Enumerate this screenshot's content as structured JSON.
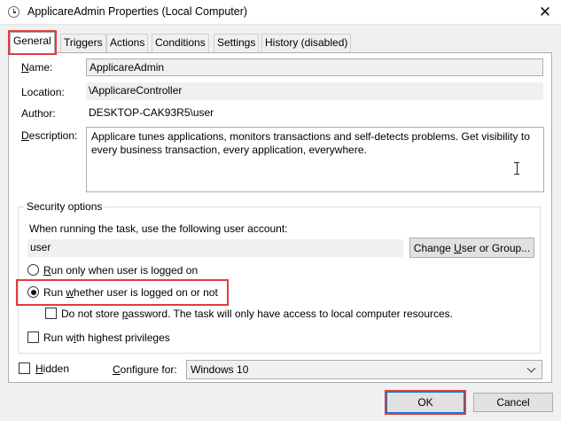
{
  "window": {
    "title": "ApplicareAdmin Properties (Local Computer)",
    "close_glyph": "✕"
  },
  "tabs": [
    {
      "label": "General",
      "active": true
    },
    {
      "label": "Triggers"
    },
    {
      "label": "Actions"
    },
    {
      "label": "Conditions"
    },
    {
      "label": "Settings"
    },
    {
      "label": "History (disabled)"
    }
  ],
  "general": {
    "name_label_u": "N",
    "name_label_rest": "ame:",
    "name_value": "ApplicareAdmin",
    "location_label": "Location:",
    "location_value": "\\ApplicareController",
    "author_label": "Author:",
    "author_value": "DESKTOP-CAK93R5\\user",
    "description_label_u": "D",
    "description_label_rest": "escription:",
    "description_value": "Applicare tunes applications, monitors transactions and self-detects problems. Get visibility to every business transaction, every application, everywhere."
  },
  "security": {
    "group_title": "Security options",
    "account_prompt": "When running the task, use the following user account:",
    "user_value": "user",
    "change_button_pre": "Change ",
    "change_button_u": "U",
    "change_button_post": "ser or Group...",
    "radio_logged_on_u": "R",
    "radio_logged_on_rest": "un only when user is logged on",
    "radio_whether_pre": "Run ",
    "radio_whether_u": "w",
    "radio_whether_post": "hether user is logged on or not",
    "selected_option": "Run whether user is logged on or not",
    "no_store_pre": "Do not store ",
    "no_store_u": "p",
    "no_store_post": "assword.  The task will only have access to local computer resources.",
    "highest_pre": "Run w",
    "highest_u": "i",
    "highest_post": "th highest privileges"
  },
  "footer": {
    "hidden_label_u": "H",
    "hidden_label_rest": "idden",
    "configure_label_u": "C",
    "configure_label_rest": "onfigure for:",
    "configure_value": "Windows 10",
    "ok_label": "OK",
    "cancel_label": "Cancel"
  },
  "colors": {
    "highlight_box": "#e03c3c",
    "dialog_bg": "#f0f0f0",
    "panel_bg": "#ffffff"
  }
}
